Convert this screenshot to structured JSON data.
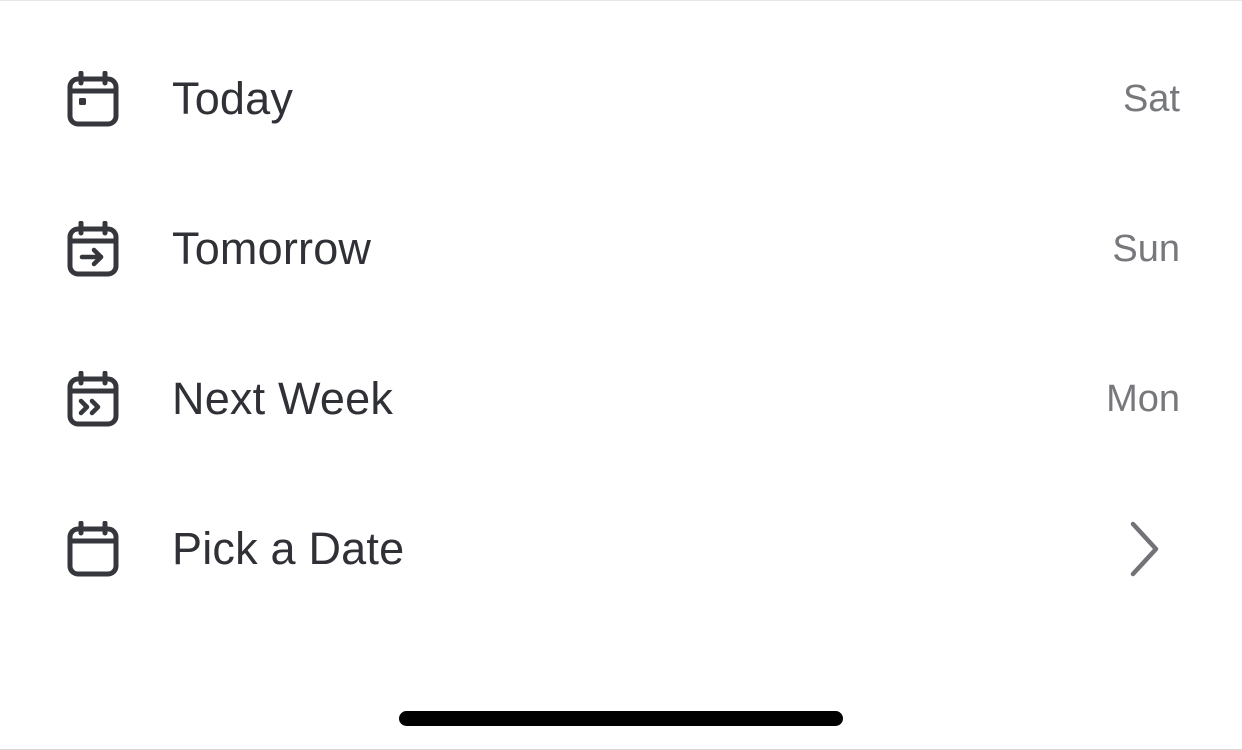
{
  "colors": {
    "icon": "#35373c",
    "label": "#2f3136",
    "day": "#77787c",
    "chevron": "#727377",
    "home_indicator": "#000000"
  },
  "options": [
    {
      "label": "Today",
      "day": "Sat",
      "icon": "calendar-dot-icon"
    },
    {
      "label": "Tomorrow",
      "day": "Sun",
      "icon": "calendar-arrow-right-icon"
    },
    {
      "label": "Next Week",
      "day": "Mon",
      "icon": "calendar-double-chevron-icon"
    },
    {
      "label": "Pick a Date",
      "icon": "calendar-blank-icon",
      "trailing_icon": "chevron-right-icon"
    }
  ]
}
